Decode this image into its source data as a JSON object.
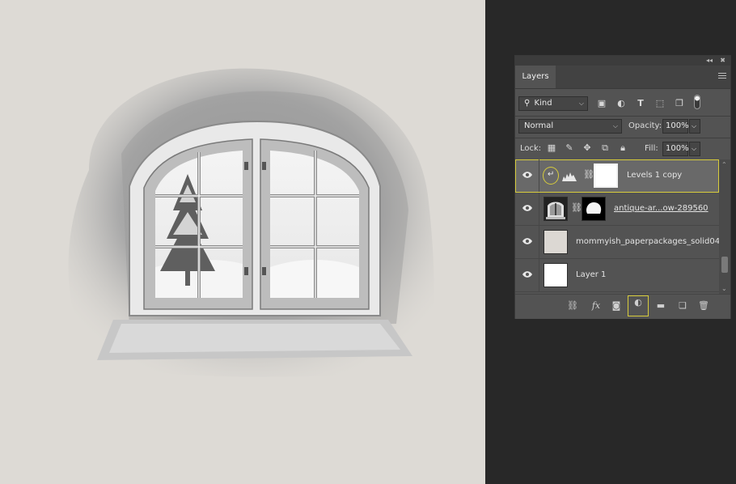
{
  "panel": {
    "collapse_icon": "double-chevron-icon",
    "close_icon": "close-icon",
    "tab_label": "Layers",
    "filter": {
      "kind_label": "Kind"
    },
    "blend_mode": "Normal",
    "opacity_label": "Opacity:",
    "opacity_value": "100%",
    "lock_label": "Lock:",
    "fill_label": "Fill:",
    "fill_value": "100%"
  },
  "layers": [
    {
      "name": "Levels 1 copy",
      "selected": true,
      "visible": true,
      "type": "adjustment-levels",
      "clipped": true
    },
    {
      "name": "antique-ar...ow-289560",
      "selected": false,
      "visible": true,
      "type": "image-with-mask",
      "underlined": true
    },
    {
      "name": "mommyish_paperpackages_solid04",
      "selected": false,
      "visible": true,
      "type": "image"
    },
    {
      "name": "Layer 1",
      "selected": false,
      "visible": true,
      "type": "image"
    }
  ],
  "colors": {
    "canvas_bg": "#dddad5",
    "panel_bg": "#535353",
    "workspace_bg": "#282828",
    "selected_row": "#696969",
    "highlight": "#d7cc3c"
  }
}
